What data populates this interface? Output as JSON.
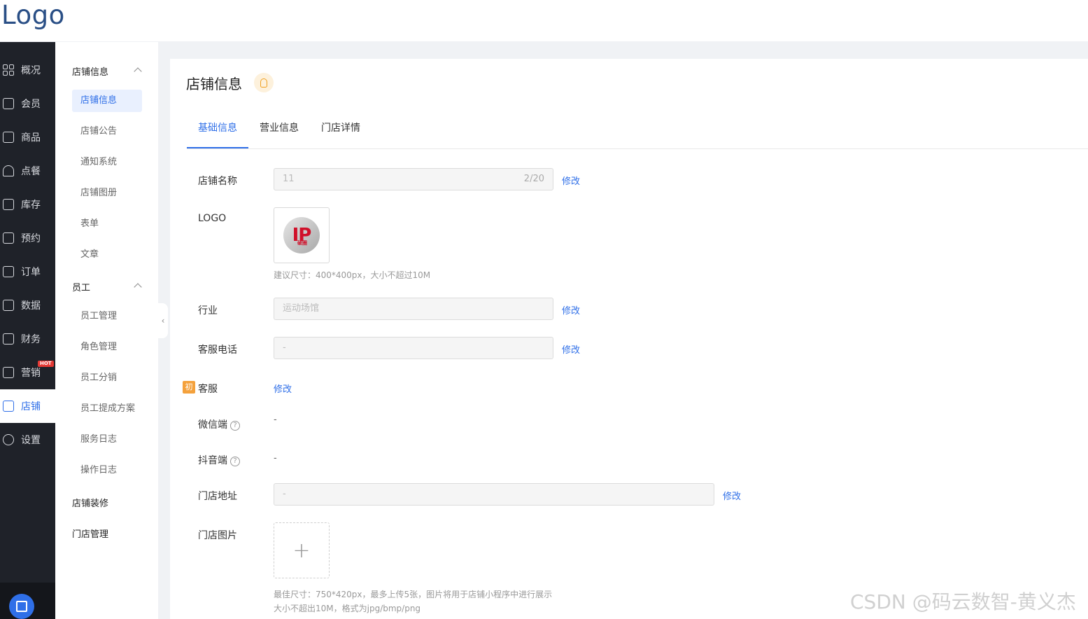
{
  "logo_text": "Logo",
  "nav": {
    "items": [
      {
        "label": "概况"
      },
      {
        "label": "会员"
      },
      {
        "label": "商品"
      },
      {
        "label": "点餐"
      },
      {
        "label": "库存"
      },
      {
        "label": "预约"
      },
      {
        "label": "订单"
      },
      {
        "label": "数据"
      },
      {
        "label": "财务"
      },
      {
        "label": "营销",
        "badge": "HOT"
      },
      {
        "label": "店铺",
        "active": true
      },
      {
        "label": "设置"
      }
    ]
  },
  "subnav": {
    "group_store": "店铺信息",
    "store_items": [
      "店铺信息",
      "店铺公告",
      "通知系统",
      "店铺图册",
      "表单",
      "文章"
    ],
    "group_staff": "员工",
    "staff_items": [
      "员工管理",
      "角色管理",
      "员工分销",
      "员工提成方案",
      "服务日志",
      "操作日志"
    ],
    "decor": "店铺装修",
    "stores": "门店管理"
  },
  "page": {
    "title": "店铺信息",
    "tabs": [
      "基础信息",
      "营业信息",
      "门店详情"
    ],
    "active_tab": "基础信息"
  },
  "form": {
    "store_name": {
      "label": "店铺名称",
      "value": "11",
      "count": "2/20",
      "action": "修改"
    },
    "logo": {
      "label": "LOGO",
      "hint": "建议尺寸：400*400px，大小不超过10M",
      "image_text": "IP",
      "image_sub": "破圈"
    },
    "industry": {
      "label": "行业",
      "value": "运动场馆",
      "action": "修改"
    },
    "phone": {
      "label": "客服电话",
      "value": "-",
      "action": "修改"
    },
    "service": {
      "label": "客服",
      "tag": "初",
      "action": "修改"
    },
    "wechat": {
      "label": "微信端",
      "value": "-"
    },
    "douyin": {
      "label": "抖音端",
      "value": "-"
    },
    "address": {
      "label": "门店地址",
      "value": "-",
      "action": "修改"
    },
    "photos": {
      "label": "门店图片",
      "hint1": "最佳尺寸：750*420px，最多上传5张，图片将用于店铺小程序中进行展示",
      "hint2": "大小不超出10M，格式为jpg/bmp/png"
    }
  },
  "watermark": "CSDN @码云数智-黄义杰",
  "colors": {
    "accent": "#2f6fe8",
    "nav_bg": "#1f2229",
    "hot": "#e53935"
  }
}
